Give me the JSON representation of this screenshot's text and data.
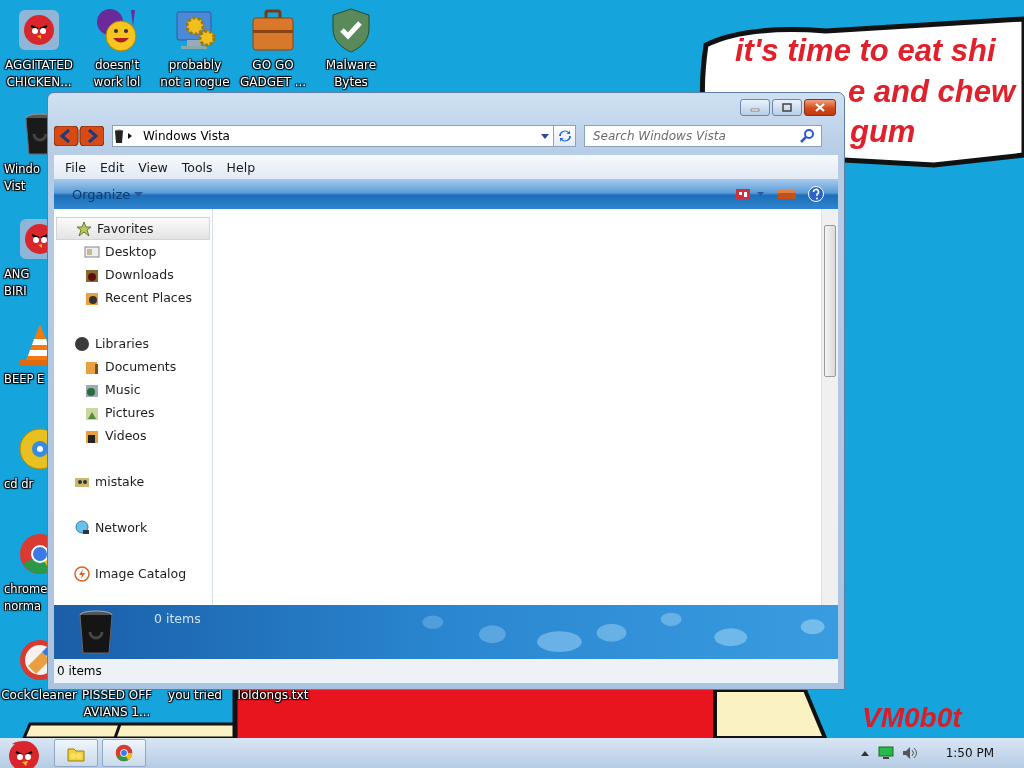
{
  "desktop": {
    "wallpaper": {
      "kind": "picture",
      "caption_lines": [
        "it's time to eat shi",
        "e and chew",
        "gum"
      ],
      "signature": "VM0b0t"
    },
    "top_row": [
      {
        "kind": "bird",
        "lines": [
          "AGGITATED",
          "CHICKEN..."
        ]
      },
      {
        "kind": "smiley",
        "lines": [
          "doesn't",
          "work lol"
        ]
      },
      {
        "kind": "gears",
        "lines": [
          "probably",
          "not a rogue"
        ]
      },
      {
        "kind": "briefcase",
        "lines": [
          "GO GO",
          "GADGET ..."
        ]
      },
      {
        "kind": "shield",
        "lines": [
          "Malware",
          "Bytes"
        ]
      }
    ],
    "left_column": [
      {
        "kind": "bin",
        "lines": [
          "Windo",
          "Vist"
        ]
      },
      {
        "kind": "bird",
        "lines": [
          "ANG",
          "BIRI"
        ]
      },
      {
        "kind": "cone",
        "lines": [
          "BEEP E"
        ]
      },
      {
        "kind": "disc",
        "lines": [
          "cd dr"
        ]
      },
      {
        "kind": "chrome",
        "lines": [
          "chrome",
          "norma"
        ]
      }
    ],
    "bottom_row": [
      {
        "kind": "cleaner",
        "lines": [
          "CockCleaner"
        ]
      },
      {
        "lines": [
          "PISSED OFF",
          "AVIANS 1..."
        ]
      },
      {
        "lines": [
          "you tried"
        ]
      },
      {
        "lines": [
          "loldongs.txt"
        ]
      }
    ]
  },
  "window": {
    "address": {
      "path": "Windows Vista"
    },
    "search": {
      "placeholder": "Search Windows Vista"
    },
    "menu": [
      "File",
      "Edit",
      "View",
      "Tools",
      "Help"
    ],
    "toolbar": {
      "organize": "Organize"
    },
    "sidebar": [
      {
        "label": "Favorites",
        "kind": "star",
        "selected": true,
        "children": [
          {
            "label": "Desktop",
            "kind": "desktop",
            "selected": false
          },
          {
            "label": "Downloads",
            "kind": "downloads",
            "selected": false
          },
          {
            "label": "Recent Places",
            "kind": "recent",
            "selected": false
          }
        ]
      },
      {
        "label": "Libraries",
        "kind": "ball",
        "selected": false,
        "children": [
          {
            "label": "Documents",
            "kind": "documents",
            "selected": false
          },
          {
            "label": "Music",
            "kind": "music",
            "selected": false
          },
          {
            "label": "Pictures",
            "kind": "pictures",
            "selected": false
          },
          {
            "label": "Videos",
            "kind": "videos",
            "selected": false
          }
        ]
      },
      {
        "label": "mistake",
        "kind": "homegroup",
        "selected": false
      },
      {
        "label": "Network",
        "kind": "network",
        "selected": false
      },
      {
        "label": "Image Catalog",
        "kind": "catalog",
        "selected": false
      }
    ],
    "details_pane": {
      "count": "0 items"
    },
    "status_bar": "0 items"
  },
  "taskbar": {
    "buttons": [
      {
        "kind": "folder"
      },
      {
        "kind": "chrome"
      }
    ],
    "clock": "1:50 PM"
  }
}
